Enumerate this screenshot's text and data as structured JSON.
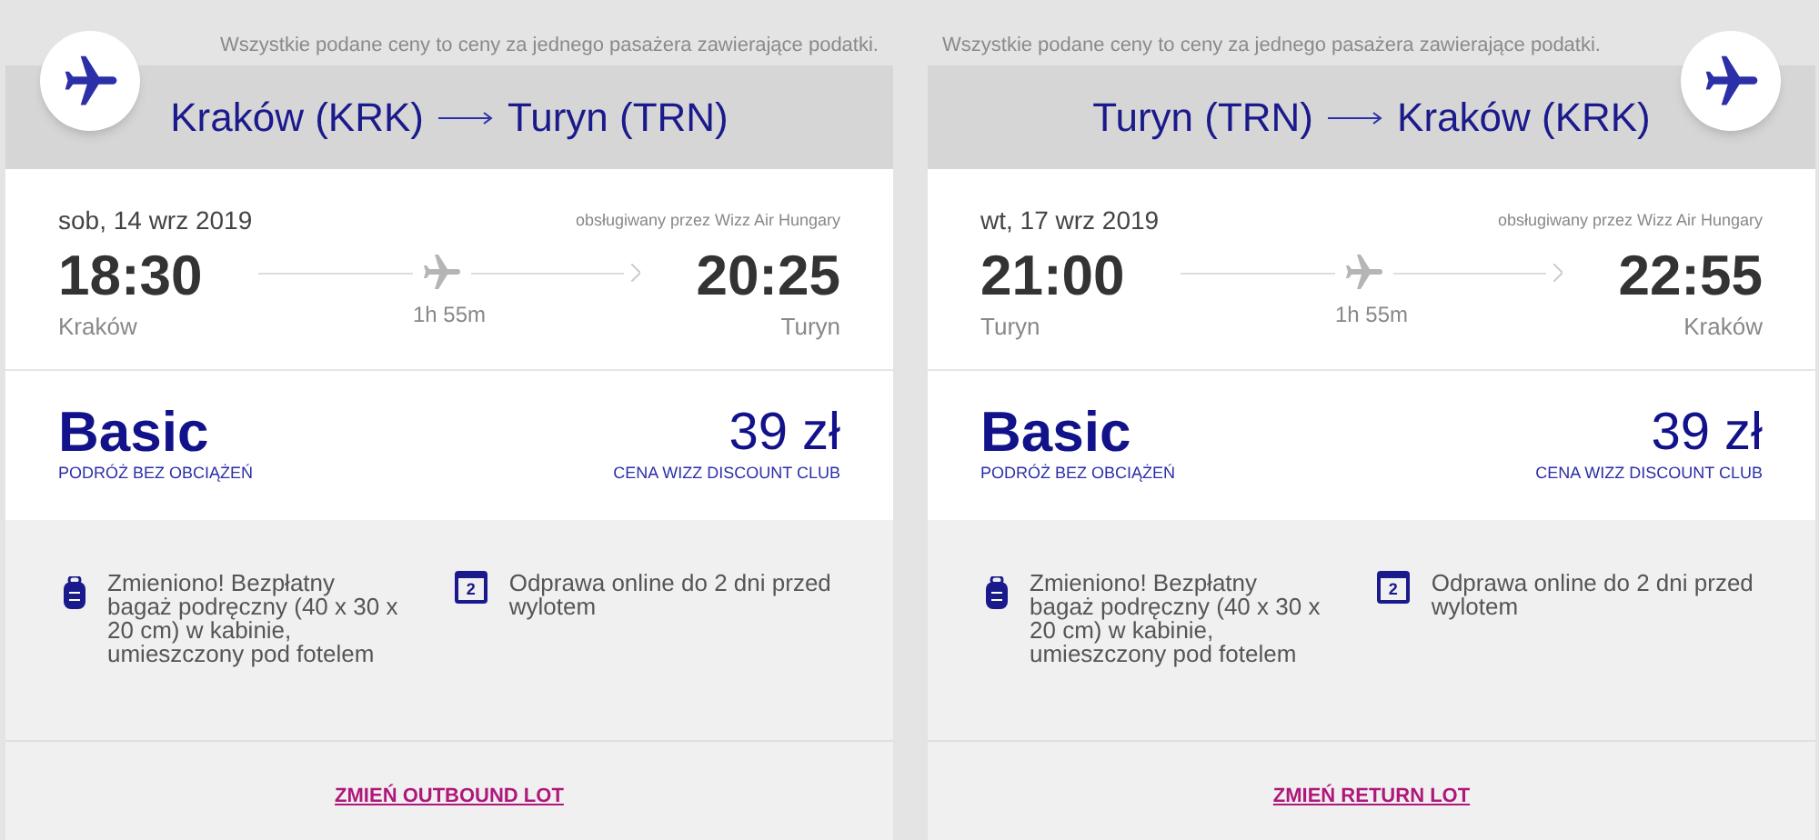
{
  "flights": [
    {
      "notice": "Wszystkie podane ceny to ceny za jednego pasażera zawierające podatki.",
      "origin": "Kraków (KRK)",
      "destination": "Turyn (TRN)",
      "date": "sob, 14 wrz 2019",
      "operator": "obsługiwany przez Wizz Air Hungary",
      "departure_time": "18:30",
      "departure_city": "Kraków",
      "duration": "1h 55m",
      "arrival_time": "20:25",
      "arrival_city": "Turyn",
      "fare_name": "Basic",
      "fare_subtitle": "PODRÓŻ BEZ OBCIĄŻEŃ",
      "price": "39 zł",
      "price_note": "CENA WIZZ DISCOUNT CLUB",
      "features": [
        {
          "kind": "bag",
          "text": "Zmieniono! Bezpłatny bagaż podręczny (40 x 30 x 20 cm) w kabinie, umieszczony pod fotelem"
        },
        {
          "kind": "calendar",
          "icon_text": "2",
          "text": "Odprawa online do 2 dni przed wylotem"
        }
      ],
      "change_link": "ZMIEŃ OUTBOUND LOT"
    },
    {
      "notice": "Wszystkie podane ceny to ceny za jednego pasażera zawierające podatki.",
      "origin": "Turyn (TRN)",
      "destination": "Kraków (KRK)",
      "date": "wt, 17 wrz 2019",
      "operator": "obsługiwany przez Wizz Air Hungary",
      "departure_time": "21:00",
      "departure_city": "Turyn",
      "duration": "1h 55m",
      "arrival_time": "22:55",
      "arrival_city": "Kraków",
      "fare_name": "Basic",
      "fare_subtitle": "PODRÓŻ BEZ OBCIĄŻEŃ",
      "price": "39 zł",
      "price_note": "CENA WIZZ DISCOUNT CLUB",
      "features": [
        {
          "kind": "bag",
          "text": "Zmieniono! Bezpłatny bagaż podręczny (40 x 30 x 20 cm) w kabinie, umieszczony pod fotelem"
        },
        {
          "kind": "calendar",
          "icon_text": "2",
          "text": "Odprawa online do 2 dni przed wylotem"
        }
      ],
      "change_link": "ZMIEŃ RETURN LOT"
    }
  ]
}
